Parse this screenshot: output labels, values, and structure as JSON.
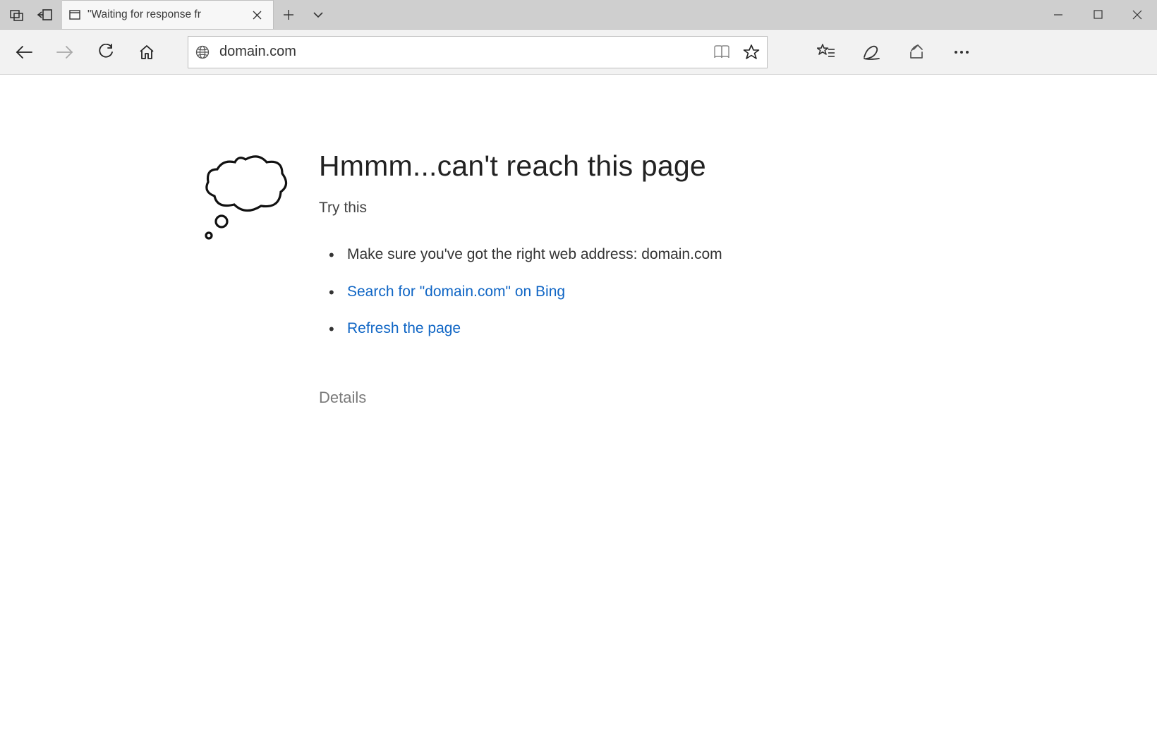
{
  "tab": {
    "title": "\"Waiting for response fr"
  },
  "address_bar": {
    "value": "domain.com"
  },
  "error_page": {
    "heading": "Hmmm...can't reach this page",
    "subheading": "Try this",
    "suggestion_text": "Make sure you've got the right web address: domain.com",
    "search_link": "Search for \"domain.com\" on Bing",
    "refresh_link": "Refresh the page",
    "details_label": "Details"
  }
}
